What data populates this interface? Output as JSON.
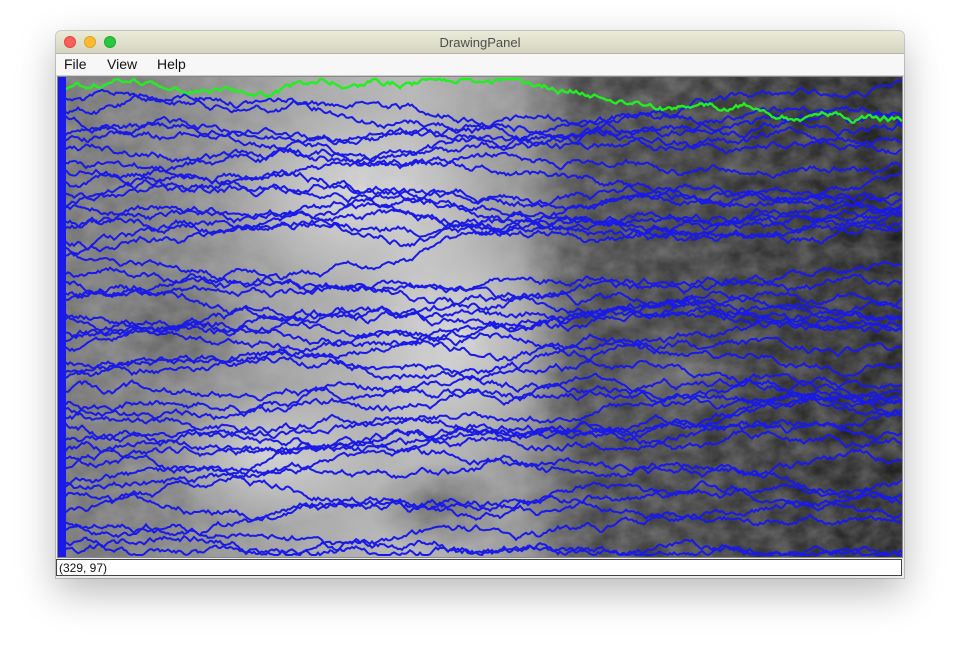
{
  "window": {
    "title": "DrawingPanel"
  },
  "menubar": {
    "items": [
      "File",
      "View",
      "Help"
    ]
  },
  "canvas": {
    "content": "elevation-map-with-paths",
    "path_colors": {
      "best": "#22ee22",
      "other": "#1a1ae8"
    }
  },
  "statusbar": {
    "coordinates": "(329, 97)"
  }
}
